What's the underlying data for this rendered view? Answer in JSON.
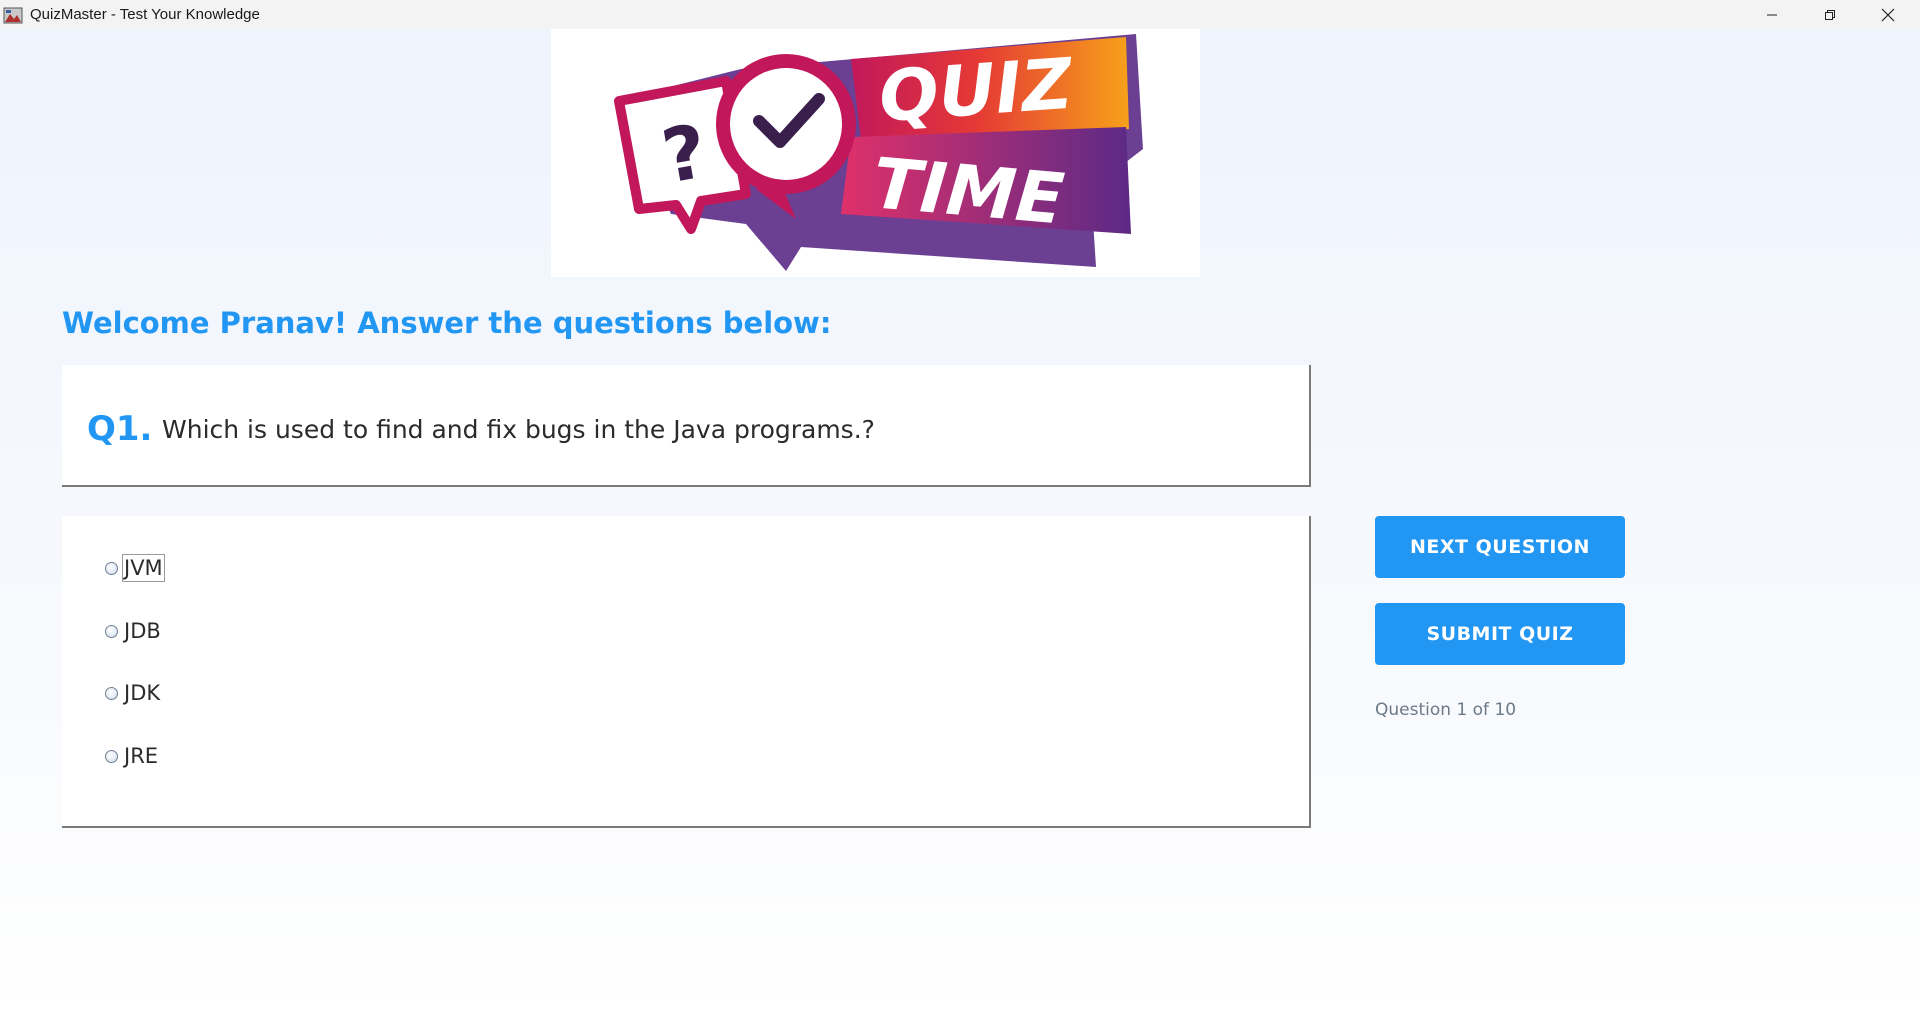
{
  "window": {
    "title": "QuizMaster - Test Your Knowledge",
    "controls": [
      "minimize-icon",
      "restore-icon",
      "close-icon"
    ]
  },
  "banner": {
    "line1": "QUIZ",
    "line2": "TIME",
    "symbol": "?",
    "icons": [
      "speech-bubble-question-icon",
      "speech-bubble-check-icon"
    ]
  },
  "welcome": "Welcome Pranav! Answer the questions below:",
  "question": {
    "number": "Q1.",
    "text": "Which is used to find and fix bugs in the Java programs.?"
  },
  "options": [
    {
      "label": "JVM",
      "selected": false,
      "focused": true
    },
    {
      "label": "JDB",
      "selected": false,
      "focused": false
    },
    {
      "label": "JDK",
      "selected": false,
      "focused": false
    },
    {
      "label": "JRE",
      "selected": false,
      "focused": false
    }
  ],
  "buttons": {
    "next": "NEXT QUESTION",
    "submit": "SUBMIT QUIZ"
  },
  "progress": "Question 1 of 10",
  "colors": {
    "accent": "#2196f3",
    "banner_magenta": "#d81b7a",
    "banner_orange": "#f7a11a",
    "banner_purple": "#5b2a86"
  }
}
